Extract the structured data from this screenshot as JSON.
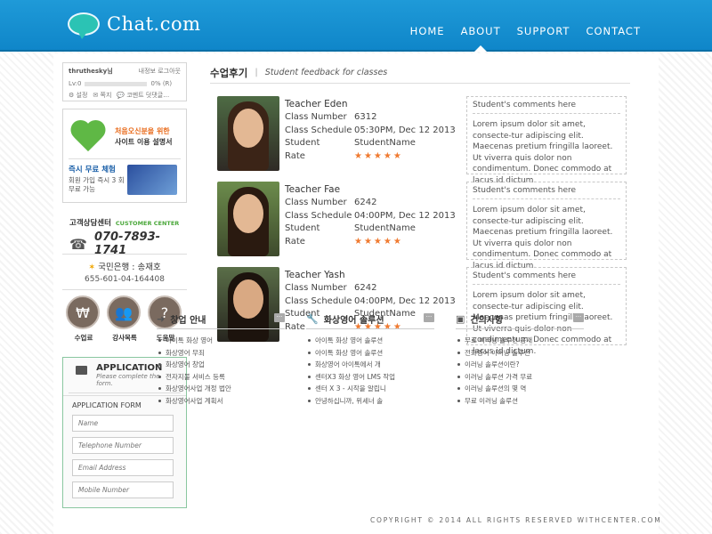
{
  "header": {
    "logo_text": "Chat.com",
    "nav": [
      "HOME",
      "ABOUT",
      "SUPPORT",
      "CONTACT"
    ],
    "active_nav": "ABOUT",
    "brand_color": "#1e95d6"
  },
  "sidebar": {
    "login": {
      "user": "thruthesky님",
      "links": [
        "내정보",
        "로그아웃"
      ],
      "level": "Lv:0",
      "progress": "0% (R)",
      "progress_fraction": 0,
      "menu": [
        "설정",
        "쪽지",
        "코멘트 덧댓글…"
      ]
    },
    "promo": {
      "line1a": "처음오신분을 위한",
      "line1b": "사이트 이용 설명서",
      "line2_title": "즉시 무료 체험",
      "line2_body": "회원 가입 즉시 3 회 무료 가능"
    },
    "customer_center": {
      "title": "고객상담센터",
      "subtitle": "CUSTOMER CENTER",
      "phone": "070-7893-1741"
    },
    "bank": {
      "name": "국민은행 : 송재호",
      "account": "655-601-04-164408"
    },
    "circles": [
      "수업료",
      "강사목록",
      "도움말"
    ],
    "application": {
      "title": "APPLICATION",
      "subtitle": "Please complete the form.",
      "form_title": "APPLICATION FORM",
      "fields": [
        "Name",
        "Telephone Number",
        "Email Address",
        "Mobile Number"
      ]
    }
  },
  "main": {
    "title_ko": "수업후기",
    "title_en": "Student feedback for classes",
    "labels": {
      "class_number": "Class Number",
      "class_schedule": "Class Schedule",
      "student": "Student",
      "rate": "Rate"
    },
    "teachers": [
      {
        "name": "Teacher Eden",
        "class_number": "6312",
        "schedule": "05:30PM, Dec 12 2013",
        "student": "StudentName",
        "rating": 5,
        "comment_title": "Student's comments here",
        "comment": "Lorem ipsum dolor sit amet, consecte-tur adipiscing elit. Maecenas pretium fringilla laoreet. Ut viverra quis dolor non condimentum. Donec commodo at lacus id dictum."
      },
      {
        "name": "Teacher Fae",
        "class_number": "6242",
        "schedule": "04:00PM, Dec 12 2013",
        "student": "StudentName",
        "rating": 5,
        "comment_title": "Student's comments here",
        "comment": "Lorem ipsum dolor sit amet, consecte-tur adipiscing elit. Maecenas pretium fringilla laoreet. Ut viverra quis dolor non condimentum. Donec commodo at lacus id dictum."
      },
      {
        "name": "Teacher Yash",
        "class_number": "6242",
        "schedule": "04:00PM, Dec 12 2013",
        "student": "StudentName",
        "rating": 5,
        "comment_title": "Student's comments here",
        "comment": "Lorem ipsum dolor sit amet, consecte-tur adipiscing elit. Maecenas pretium fringilla laoreet. Ut viverra quis dolor non condimentum. Donec commodo at lacus id dictum."
      }
    ]
  },
  "lists": [
    {
      "icon": "signpost-icon",
      "title": "창업 안내",
      "items": [
        "아이톡 화상 영어",
        "화상영어 무죄",
        "화상영어 창업",
        "전자지불 서비스 등록",
        "화상영어사업 개정 법안",
        "화상영어사업 계획서"
      ]
    },
    {
      "icon": "wrench-icon",
      "title": "화상영어 솔루션",
      "items": [
        "아이톡 화상 영어 솔루션",
        "아이톡 화상 영어 솔루션",
        "화상영어 아이톡에서 개",
        "센터X3 화상 영어 LMS 작업",
        "센터 X 3 - 시작을 알립니",
        "안녕하십니까, 위세너 솔"
      ]
    },
    {
      "icon": "inbox-icon",
      "title": "건의사항",
      "items": [
        "무료 이러닝 솔루션 공개",
        "전화영어 이러닝 솔루션",
        "이러닝 솔루션이란?",
        "이러닝 솔루션 가격 무료",
        "이러닝 솔루션의 몇 역",
        "무료 이러닝 솔루션"
      ]
    }
  ],
  "footer": "COPYRIGHT © 2014   ALL RIGHTS RESERVED   WITHCENTER.COM"
}
